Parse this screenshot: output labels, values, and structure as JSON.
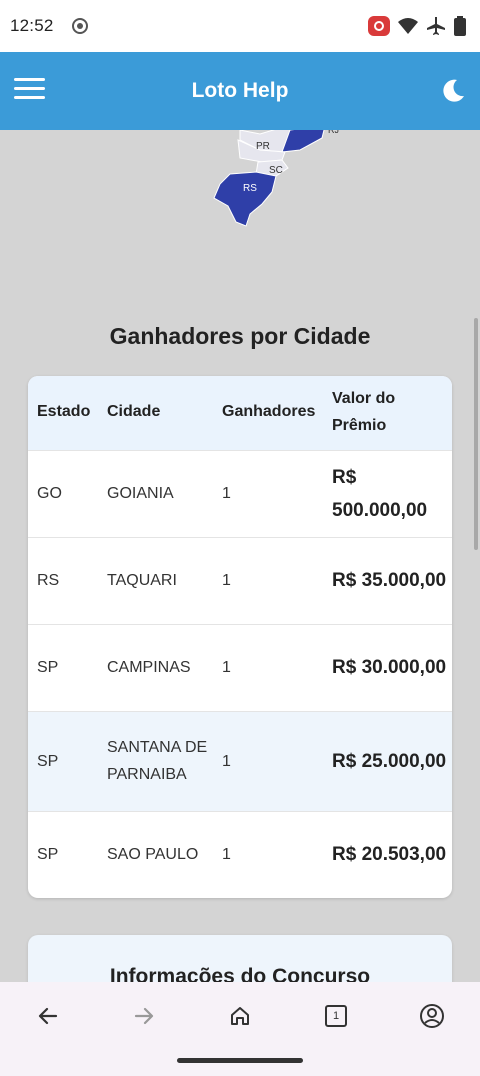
{
  "status_bar": {
    "time": "12:52",
    "icons": [
      "settings-dot-icon",
      "screen-record-icon",
      "wifi-icon",
      "airplane-icon",
      "battery-icon"
    ]
  },
  "app_bar": {
    "title": "Loto Help",
    "menu_icon": "hamburger-menu-icon",
    "theme_icon": "moon-icon"
  },
  "map": {
    "labels": [
      "PR",
      "SC",
      "RS",
      "RJ"
    ],
    "highlight_color": "#2f3fa8",
    "base_color": "#e6e6ee"
  },
  "winners_section": {
    "title": "Ganhadores por Cidade",
    "columns": [
      "Estado",
      "Cidade",
      "Ganhadores",
      "Valor do Prêmio"
    ],
    "rows": [
      {
        "estado": "GO",
        "cidade": "GOIANIA",
        "ganhadores": "1",
        "valor": "R$ 500.000,00"
      },
      {
        "estado": "RS",
        "cidade": "TAQUARI",
        "ganhadores": "1",
        "valor": "R$ 35.000,00"
      },
      {
        "estado": "SP",
        "cidade": "CAMPINAS",
        "ganhadores": "1",
        "valor": "R$ 30.000,00"
      },
      {
        "estado": "SP",
        "cidade": "SANTANA DE PARNAIBA",
        "ganhadores": "1",
        "valor": "R$ 25.000,00"
      },
      {
        "estado": "SP",
        "cidade": "SAO PAULO",
        "ganhadores": "1",
        "valor": "R$ 20.503,00"
      }
    ]
  },
  "info_section": {
    "title": "Informações do Concurso"
  },
  "bottom_nav": {
    "tab_count": "1",
    "icons": [
      "back-arrow-icon",
      "forward-arrow-icon",
      "home-icon",
      "tabs-icon",
      "account-icon"
    ]
  },
  "colors": {
    "app_bar": "#3b9bd8",
    "background": "#d4d4d4",
    "header_row": "#eaf3fd"
  }
}
